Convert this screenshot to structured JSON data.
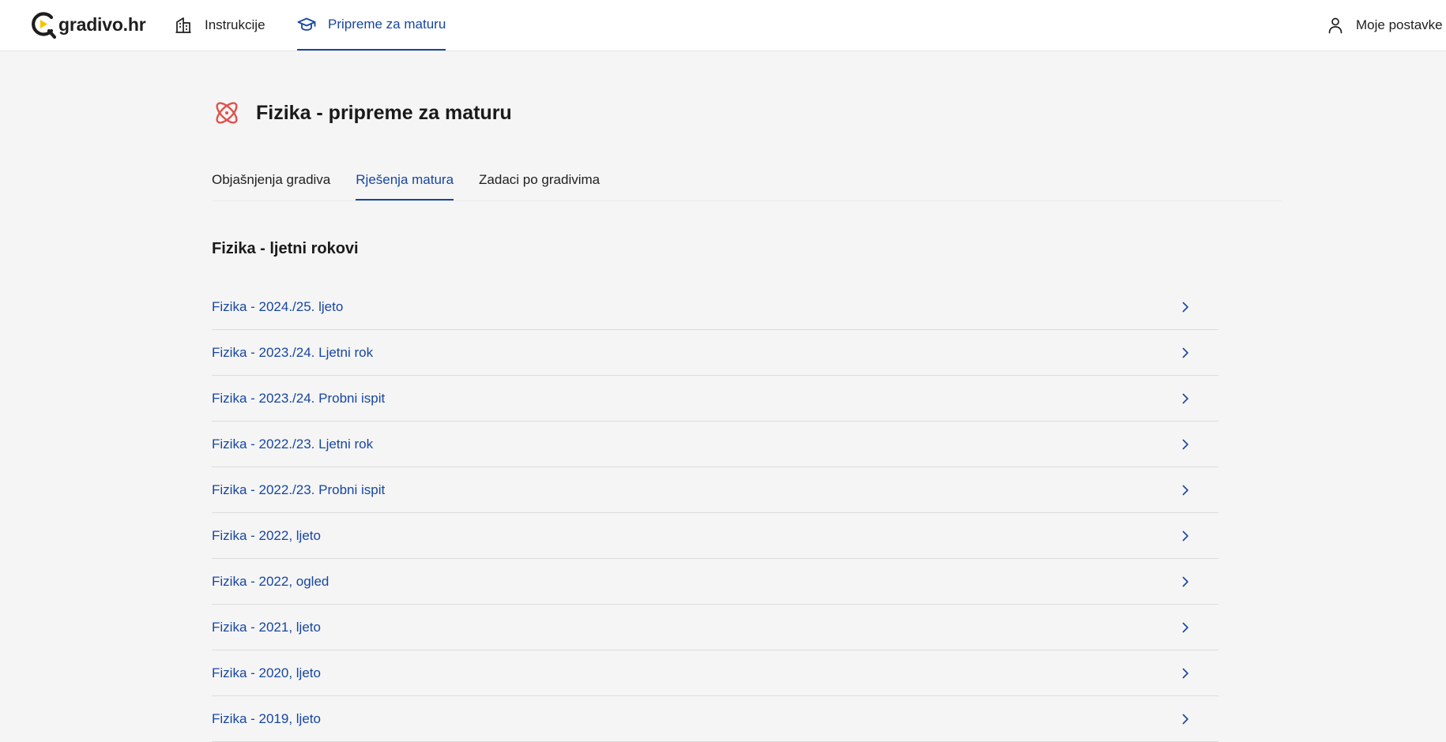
{
  "header": {
    "logo_text": "gradivo.hr",
    "nav": [
      {
        "label": "Instrukcije",
        "icon": "building-icon"
      },
      {
        "label": "Pripreme za maturu",
        "icon": "graduation-cap-icon",
        "active": true
      }
    ],
    "settings_label": "Moje postavke",
    "settings_icon": "user-icon"
  },
  "page": {
    "title": "Fizika - pripreme za maturu",
    "icon": "atom-icon"
  },
  "tabs": [
    {
      "label": "Objašnjenja gradiva",
      "active": false
    },
    {
      "label": "Rješenja matura",
      "active": true
    },
    {
      "label": "Zadaci po gradivima",
      "active": false
    }
  ],
  "section": {
    "title": "Fizika - ljetni rokovi",
    "items": [
      {
        "label": "Fizika - 2024./25. ljeto"
      },
      {
        "label": "Fizika - 2023./24. Ljetni rok"
      },
      {
        "label": "Fizika - 2023./24. Probni ispit"
      },
      {
        "label": "Fizika - 2022./23. Ljetni rok"
      },
      {
        "label": "Fizika - 2022./23. Probni ispit"
      },
      {
        "label": "Fizika - 2022, ljeto"
      },
      {
        "label": "Fizika - 2022, ogled"
      },
      {
        "label": "Fizika - 2021, ljeto"
      },
      {
        "label": "Fizika - 2020, ljeto"
      },
      {
        "label": "Fizika - 2019, ljeto"
      }
    ]
  },
  "colors": {
    "accent": "#1746a2",
    "logo_accent": "#f5c400",
    "atom": "#e0504a",
    "background": "#f5f5f5"
  }
}
